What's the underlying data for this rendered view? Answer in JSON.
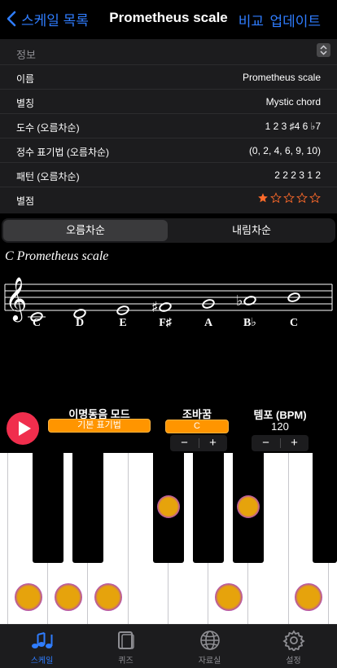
{
  "nav": {
    "back_label": "스케일 목록",
    "title": "Prometheus scale",
    "compare_label": "비교",
    "update_label": "업데이트"
  },
  "info": {
    "header": "정보",
    "rows": [
      {
        "label": "이름",
        "value": "Prometheus scale"
      },
      {
        "label": "별칭",
        "value": "Mystic chord"
      },
      {
        "label": "도수 (오름차순)",
        "value": "1 2 3 ♯4 6 ♭7"
      },
      {
        "label": "정수 표기법 (오름차순)",
        "value": "(0, 2, 4, 6, 9, 10)"
      },
      {
        "label": "패턴 (오름차순)",
        "value": "2 2 2 3 1 2"
      },
      {
        "label": "별점",
        "rating": 1,
        "max": 5
      }
    ]
  },
  "segment": {
    "ascending_label": "오름차순",
    "descending_label": "내림차순",
    "selected": "ascending"
  },
  "staff": {
    "title": "C Prometheus scale",
    "notes": [
      "C",
      "D",
      "E",
      "F♯",
      "A",
      "B♭",
      "C"
    ]
  },
  "controls": {
    "solfege_label": "이명동음 모드",
    "solfege_value": "기본 표기법",
    "transpose_label": "조바꿈",
    "transpose_value": "C",
    "tempo_label": "템포 (BPM)",
    "tempo_value": "120",
    "minus": "−",
    "plus": "+"
  },
  "tabs": [
    {
      "label": "스케일",
      "icon": "music-notes-icon",
      "active": true
    },
    {
      "label": "퀴즈",
      "icon": "cards-icon",
      "active": false
    },
    {
      "label": "자료실",
      "icon": "globe-icon",
      "active": false
    },
    {
      "label": "설정",
      "icon": "gear-icon",
      "active": false
    }
  ],
  "colors": {
    "accent": "#2f7dff",
    "play": "#f02e4d",
    "pill": "#ff9500",
    "star": "#ff6a2a"
  }
}
